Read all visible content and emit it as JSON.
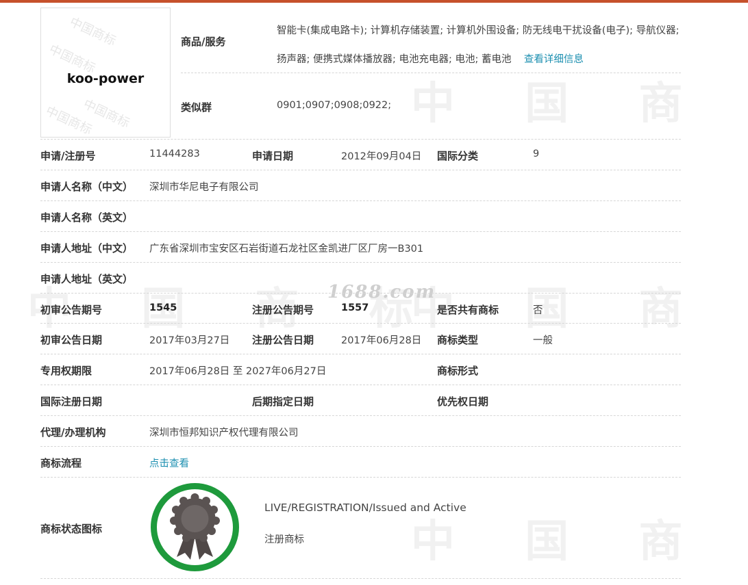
{
  "colors": {
    "accent": "#c6512b",
    "link": "#1c8fb0",
    "badge_ring": "#1e9a3c",
    "badge_seal": "#5a5352"
  },
  "logo": {
    "text": "koo-power",
    "watermark": "中国商标"
  },
  "watermark_site": "1688.com",
  "goods": {
    "label": "商品/服务",
    "text": "智能卡(集成电路卡); 计算机存储装置; 计算机外围设备; 防无线电干扰设备(电子); 导航仪器; 扬声器; 便携式媒体播放器; 电池充电器; 电池; 蓄电池",
    "more_link": "查看详细信息"
  },
  "similar_group": {
    "label": "类似群",
    "value": "0901;0907;0908;0922;"
  },
  "rows": {
    "reg_no_label": "申请/注册号",
    "reg_no": "11444283",
    "apply_date_label": "申请日期",
    "apply_date": "2012年09月04日",
    "intl_class_label": "国际分类",
    "intl_class": "9",
    "applicant_cn_label": "申请人名称（中文）",
    "applicant_cn": "深圳市华尼电子有限公司",
    "applicant_en_label": "申请人名称（英文）",
    "applicant_en": "",
    "address_cn_label": "申请人地址（中文）",
    "address_cn": "广东省深圳市宝安区石岩街道石龙社区金凯进厂区厂房一B301",
    "address_en_label": "申请人地址（英文）",
    "address_en": "",
    "prelim_no_label": "初审公告期号",
    "prelim_no": "1545",
    "reg_pub_no_label": "注册公告期号",
    "reg_pub_no": "1557",
    "shared_label": "是否共有商标",
    "shared": "否",
    "prelim_date_label": "初审公告日期",
    "prelim_date": "2017年03月27日",
    "reg_pub_date_label": "注册公告日期",
    "reg_pub_date": "2017年06月28日",
    "tm_type_label": "商标类型",
    "tm_type": "一般",
    "exclusive_label": "专用权期限",
    "exclusive": "2017年06月28日 至 2027年06月27日",
    "tm_form_label": "商标形式",
    "tm_form": "",
    "intl_reg_date_label": "国际注册日期",
    "intl_reg_date": "",
    "later_date_label": "后期指定日期",
    "later_date": "",
    "priority_date_label": "优先权日期",
    "priority_date": "",
    "agent_label": "代理/办理机构",
    "agent": "深圳市恒邦知识产权代理有限公司",
    "process_label": "商标流程",
    "process_link": "点击查看"
  },
  "status": {
    "label": "商标状态图标",
    "en": "LIVE/REGISTRATION/Issued and Active",
    "cn": "注册商标"
  }
}
